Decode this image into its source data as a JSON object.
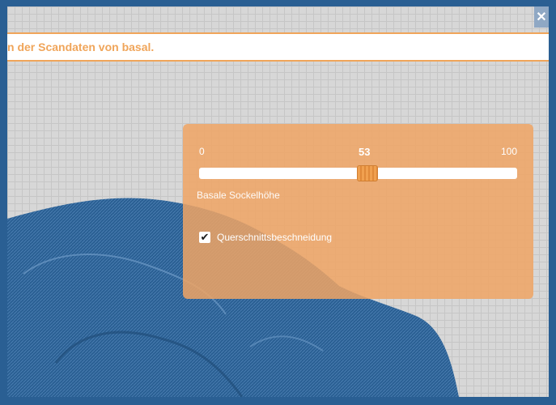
{
  "window": {
    "close_glyph": "✕"
  },
  "info_bar": {
    "text": "n der Scandaten von basal."
  },
  "panel": {
    "scale_min": "0",
    "scale_value": "53",
    "scale_max": "100",
    "slider": {
      "value": 53,
      "min": 0,
      "max": 100,
      "caption": "Basale Sockelhöhe"
    },
    "checkbox": {
      "checked": true,
      "check_glyph": "✔",
      "label": "Querschnittsbeschneidung"
    }
  },
  "colors": {
    "accent": "#f0a55a",
    "panel": "#f0a564",
    "model": "#2a5f93",
    "frame": "#2a5f93",
    "grid": "#d7d7d7"
  }
}
